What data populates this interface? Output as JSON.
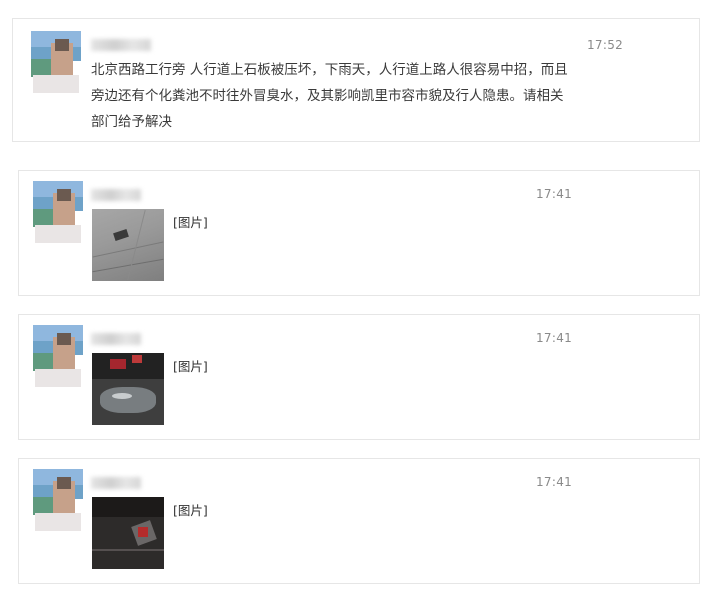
{
  "messages": [
    {
      "time": "17:52",
      "text_line1": "北京西路工行旁 人行道上石板被压坏，下雨天，人行道上路人很容易中招，而且",
      "text_line2": "旁边还有个化粪池不时往外冒臭水，及其影响凯里市容市貌及行人隐患。请相关",
      "text_line3": "部门给予解决"
    },
    {
      "time": "17:41",
      "image_label": "[图片]"
    },
    {
      "time": "17:41",
      "image_label": "[图片]"
    },
    {
      "time": "17:41",
      "image_label": "[图片]"
    }
  ]
}
